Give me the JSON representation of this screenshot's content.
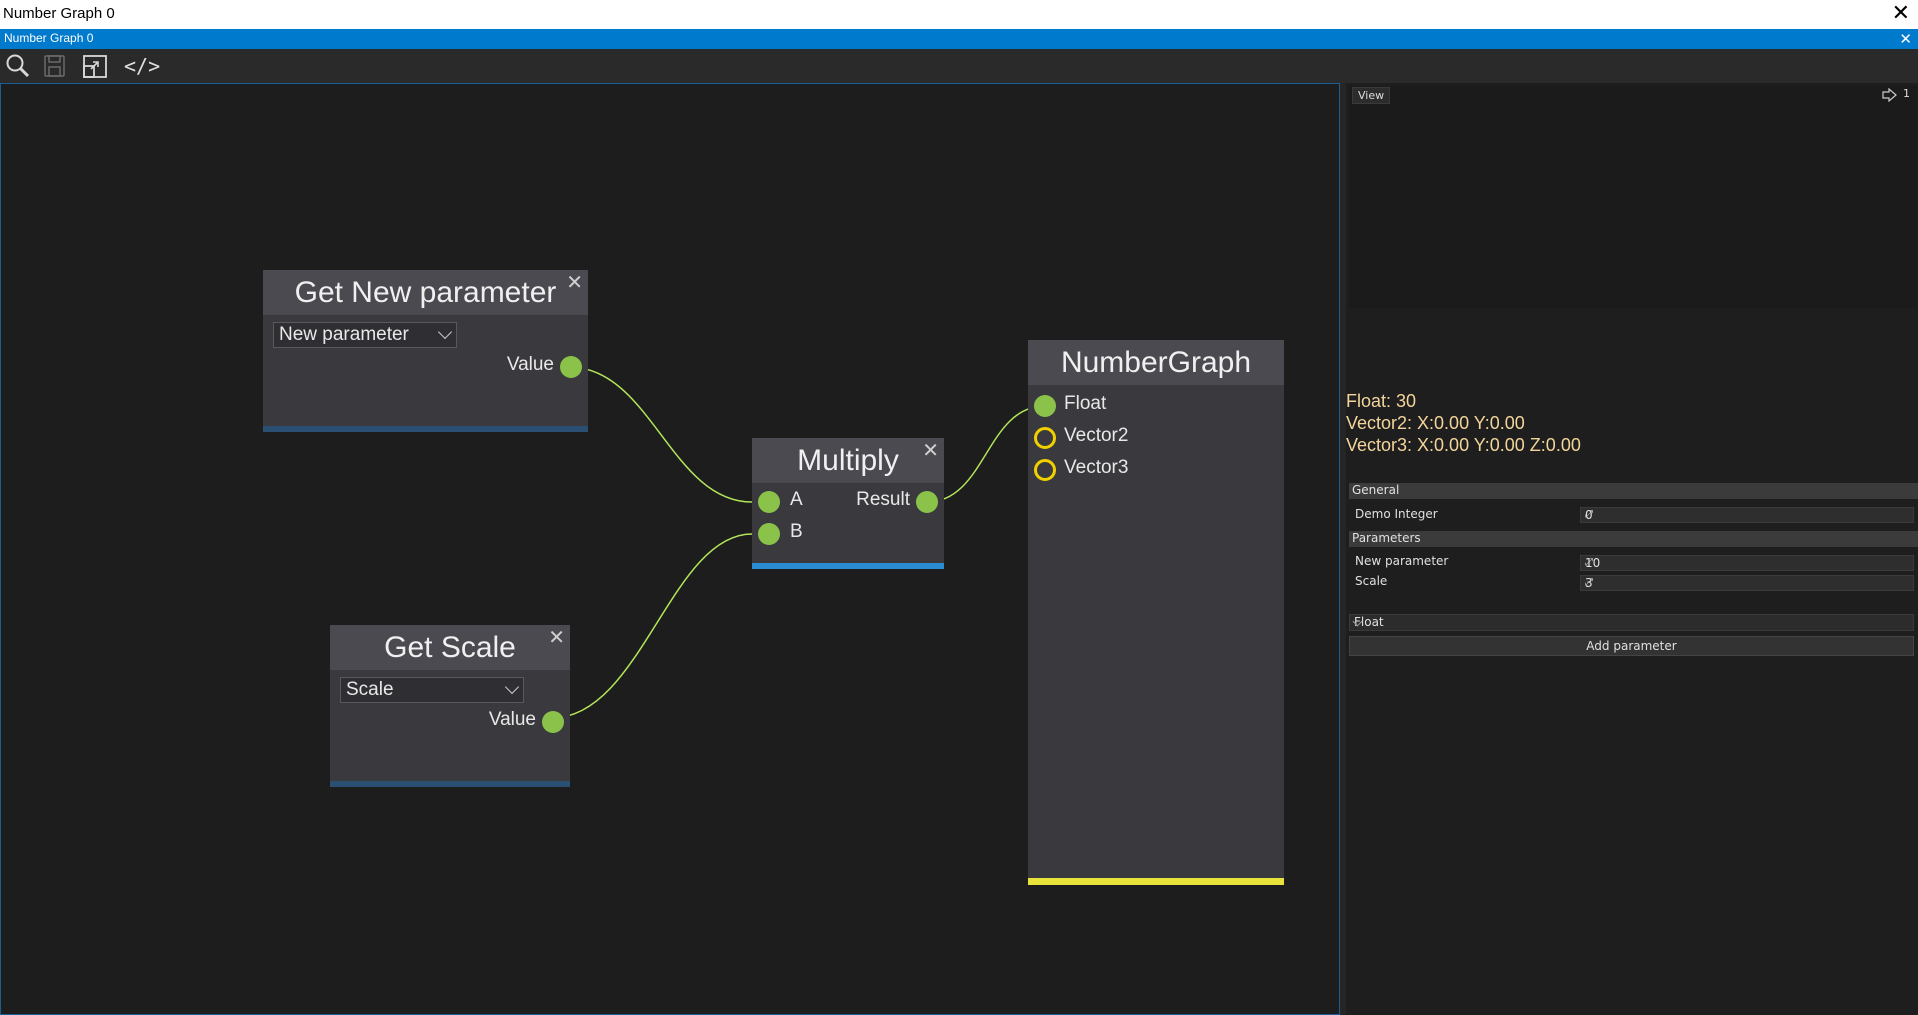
{
  "window": {
    "title": "Number Graph 0",
    "close_icon": "✕"
  },
  "tab": {
    "label": "Number Graph 0",
    "close_icon": "✕"
  },
  "toolbar": {
    "icons": [
      "search-icon",
      "save-icon",
      "fit-view-icon",
      "code-icon"
    ],
    "code_label": "</>"
  },
  "nodes": {
    "get_new_parameter": {
      "title": "Get New parameter",
      "close": "✕",
      "dropdown_value": "New parameter",
      "output_label": "Value"
    },
    "get_scale": {
      "title": "Get Scale",
      "close": "✕",
      "dropdown_value": "Scale",
      "output_label": "Value"
    },
    "multiply": {
      "title": "Multiply",
      "close": "✕",
      "input_a": "A",
      "input_b": "B",
      "output_label": "Result"
    },
    "number_graph": {
      "title": "NumberGraph",
      "inputs": [
        "Float",
        "Vector2",
        "Vector3"
      ]
    }
  },
  "colors": {
    "connection": "#b4e65a",
    "pin_green": "#8bc34a",
    "pin_ring": "#f0d000",
    "footer_blue": "#2a8dd4",
    "footer_yellow": "#e7e33b",
    "accent": "#007acc"
  },
  "preview": {
    "view_button": "View",
    "counter": "1",
    "float_line": "Float: 30",
    "vector2_line": "Vector2: X:0.00 Y:0.00",
    "vector3_line": "Vector3: X:0.00 Y:0.00 Z:0.00"
  },
  "properties": {
    "general_header": "General",
    "demo_integer_label": "Demo Integer",
    "demo_integer_value": "0",
    "parameters_header": "Parameters",
    "new_parameter_label": "New parameter",
    "new_parameter_value": "10",
    "scale_label": "Scale",
    "scale_value": "3",
    "type_select": "Float",
    "add_parameter_button": "Add parameter"
  }
}
